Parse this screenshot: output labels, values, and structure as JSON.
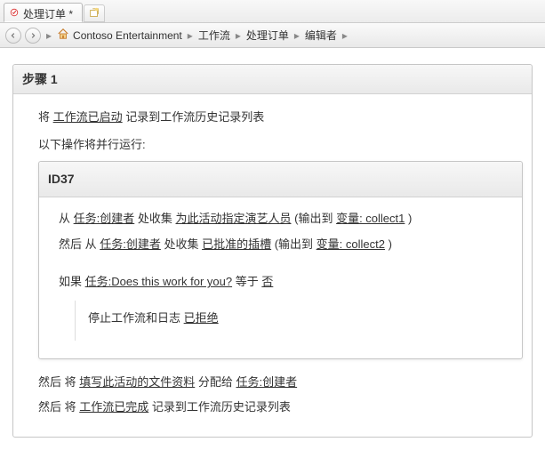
{
  "tab": {
    "title": "处理订单 *"
  },
  "breadcrumb": {
    "site": "Contoso Entertainment",
    "level1": "工作流",
    "level2": "处理订单",
    "level3": "编辑者"
  },
  "step": {
    "title": "步骤 1",
    "line1": {
      "pre": "将 ",
      "a": "工作流已启动",
      "post": " 记录到工作流历史记录列表"
    },
    "parallel": "以下操作将并行运行:",
    "idbox": {
      "title": "ID37",
      "r1": {
        "t1": "从 ",
        "a1": "任务:创建者",
        "t2": " 处收集 ",
        "a2": "为此活动指定演艺人员",
        "t3": " (输出到 ",
        "a3": "变量: collect1",
        "t4": " )"
      },
      "r2": {
        "t1": "然后 从 ",
        "a1": "任务:创建者",
        "t2": " 处收集 ",
        "a2": "已批准的插槽",
        "t3": " (输出到 ",
        "a3": "变量: collect2",
        "t4": " )"
      },
      "ifline": {
        "t1": "如果 ",
        "a1": "任务:Does this work for you?",
        "t2": " 等于 ",
        "a2": "否"
      },
      "ifbody": {
        "t1": "停止工作流和日志 ",
        "a1": "已拒绝"
      }
    },
    "after1": {
      "t1": "然后 将 ",
      "a1": "填写此活动的文件资料",
      "t2": " 分配给 ",
      "a2": "任务:创建者"
    },
    "after2": {
      "t1": "然后 将 ",
      "a1": "工作流已完成",
      "t2": " 记录到工作流历史记录列表"
    }
  }
}
